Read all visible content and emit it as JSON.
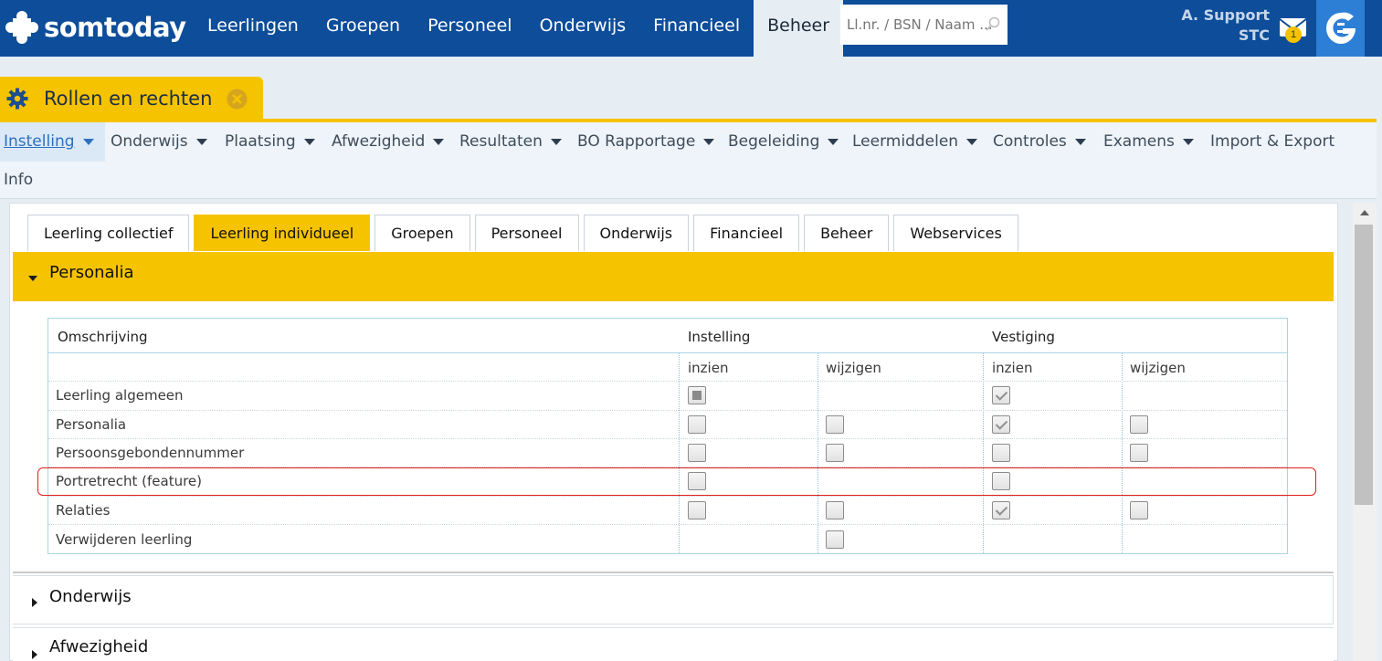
{
  "brand": {
    "name": "somtoday"
  },
  "main_nav": [
    "Leerlingen",
    "Groepen",
    "Personeel",
    "Onderwijs",
    "Financieel",
    "Beheer"
  ],
  "main_nav_active": "Beheer",
  "search": {
    "placeholder": "Ll.nr. / BSN / Naam ..."
  },
  "user": {
    "name": "A. Support",
    "org": "STC"
  },
  "mail": {
    "badge": "1"
  },
  "page_tab": {
    "title": "Rollen en rechten"
  },
  "sub_nav": [
    {
      "label": "Instelling",
      "caret": true,
      "active": true
    },
    {
      "label": "Onderwijs",
      "caret": true
    },
    {
      "label": "Plaatsing",
      "caret": true
    },
    {
      "label": "Afwezigheid",
      "caret": true
    },
    {
      "label": "Resultaten",
      "caret": true
    },
    {
      "label": "BO Rapportage",
      "caret": true
    },
    {
      "label": "Begeleiding",
      "caret": true
    },
    {
      "label": "Leermiddelen",
      "caret": true
    },
    {
      "label": "Controles",
      "caret": true
    },
    {
      "label": "Examens",
      "caret": true
    },
    {
      "label": "Import & Export",
      "caret": false
    },
    {
      "label": "Info",
      "caret": false
    }
  ],
  "content_tabs": [
    "Leerling collectief",
    "Leerling individueel",
    "Groepen",
    "Personeel",
    "Onderwijs",
    "Financieel",
    "Beheer",
    "Webservices"
  ],
  "content_tabs_active": "Leerling individueel",
  "sections": {
    "personalia": "Personalia",
    "onderwijs": "Onderwijs",
    "afwezigheid": "Afwezigheid"
  },
  "table": {
    "headers": {
      "omschrijving": "Omschrijving",
      "instelling": "Instelling",
      "vestiging": "Vestiging"
    },
    "subheaders": {
      "inzien": "inzien",
      "wijzigen": "wijzigen"
    },
    "rows": [
      {
        "label": "Leerling algemeen",
        "cells": [
          "partial",
          "none",
          "checked",
          "none"
        ]
      },
      {
        "label": "Personalia",
        "cells": [
          "empty",
          "empty",
          "checked",
          "empty"
        ]
      },
      {
        "label": "Persoonsgebondennummer",
        "cells": [
          "empty",
          "empty",
          "empty",
          "empty"
        ]
      },
      {
        "label": "Portretrecht (feature)",
        "cells": [
          "empty",
          "none",
          "empty",
          "none"
        ]
      },
      {
        "label": "Relaties",
        "cells": [
          "empty",
          "empty",
          "checked",
          "empty"
        ]
      },
      {
        "label": "Verwijderen leerling",
        "cells": [
          "none",
          "empty",
          "none",
          "none"
        ]
      }
    ]
  },
  "highlighted_row": "Portretrecht (feature)",
  "colors": {
    "brand_blue": "#0d4d9a",
    "accent_yellow": "#f6c300",
    "highlight_red": "#e0201b"
  }
}
